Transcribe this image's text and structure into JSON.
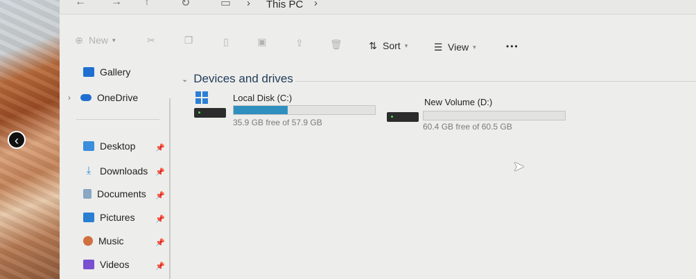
{
  "address": {
    "path_label": "This PC"
  },
  "toolbar": {
    "new_label": "New",
    "sort_label": "Sort",
    "view_label": "View",
    "more_label": "•••"
  },
  "nav": {
    "gallery": "Gallery",
    "onedrive": "OneDrive",
    "desktop": "Desktop",
    "downloads": "Downloads",
    "documents": "Documents",
    "pictures": "Pictures",
    "music": "Music",
    "videos": "Videos"
  },
  "main": {
    "section_title": "Devices and drives",
    "drives": [
      {
        "name": "Local Disk (C:)",
        "free_text": "35.9 GB free of 57.9 GB",
        "used_fraction": 0.38
      },
      {
        "name": "New Volume (D:)",
        "free_text": "60.4 GB free of 60.5 GB",
        "used_fraction": 0.0
      }
    ]
  },
  "colors": {
    "accent": "#2f8fbf",
    "folder_blue": "#1f6fd1"
  }
}
